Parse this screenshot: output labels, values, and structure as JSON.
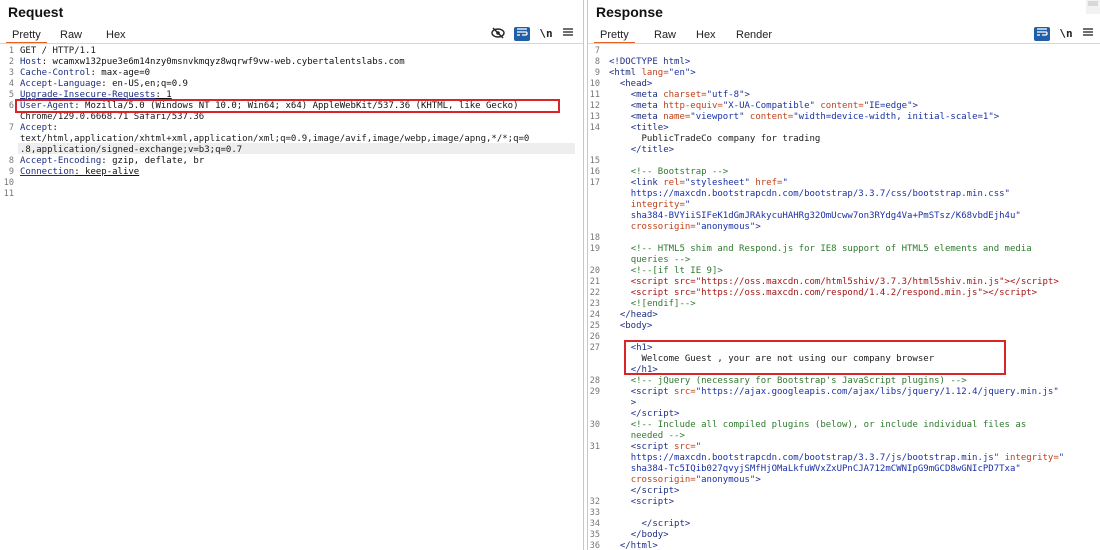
{
  "request": {
    "title": "Request",
    "tabs": [
      "Pretty",
      "Raw",
      "Hex"
    ],
    "tools": {
      "eye_off": "eye-off-icon",
      "wrap": "wrap-icon",
      "newline": "\\n",
      "menu": "menu-icon"
    },
    "lines": [
      {
        "n": "1",
        "key": "",
        "text": "GET / HTTP/1.1"
      },
      {
        "n": "2",
        "key": "Host",
        "text": ": wcamxw132pue3e6m14nzy0msnvkmqyz8wqrwf9vw-web.cybertalentslabs.com"
      },
      {
        "n": "3",
        "key": "Cache-Control",
        "text": ": max-age=0"
      },
      {
        "n": "4",
        "key": "Accept-Language",
        "text": ": en-US,en;q=0.9"
      },
      {
        "n": "5",
        "key": "Upgrade-Insecure-Requests",
        "text": ": 1"
      },
      {
        "n": "6",
        "key": "User-Agent",
        "text": ": Mozilla/5.0 (Windows NT 10.0; Win64; x64) AppleWebKit/537.36 (KHTML, like Gecko)"
      },
      {
        "n": "",
        "key": "",
        "text": "Chrome/129.0.6668.71 Safari/537.36"
      },
      {
        "n": "7",
        "key": "Accept",
        "text": ":"
      },
      {
        "n": "",
        "key": "",
        "text": "text/html,application/xhtml+xml,application/xml;q=0.9,image/avif,image/webp,image/apng,*/*;q=0"
      },
      {
        "n": "",
        "key": "",
        "text": ".8,application/signed-exchange;v=b3;q=0.7"
      },
      {
        "n": "8",
        "key": "Accept-Encoding",
        "text": ": gzip, deflate, br"
      },
      {
        "n": "9",
        "key": "Connection",
        "text": ": keep-alive"
      },
      {
        "n": "10",
        "key": "",
        "text": ""
      },
      {
        "n": "11",
        "key": "",
        "text": ""
      }
    ]
  },
  "response": {
    "title": "Response",
    "tabs": [
      "Pretty",
      "Raw",
      "Hex",
      "Render"
    ],
    "tools": {
      "wrap": "wrap-icon",
      "newline": "\\n",
      "menu": "menu-icon"
    },
    "lines": [
      {
        "n": "7",
        "html": ""
      },
      {
        "n": "8",
        "html": "<span class='tag'>&lt;!DOCTYPE html&gt;</span>"
      },
      {
        "n": "9",
        "html": "<span class='tag'>&lt;html</span> <span class='an'>lang=</span><span class='av'>\"en\"</span><span class='tag'>&gt;</span>"
      },
      {
        "n": "10",
        "html": "  <span class='tag'>&lt;head&gt;</span>"
      },
      {
        "n": "11",
        "html": "    <span class='tag'>&lt;meta</span> <span class='an'>charset=</span><span class='av'>\"utf-8\"</span><span class='tag'>&gt;</span>"
      },
      {
        "n": "12",
        "html": "    <span class='tag'>&lt;meta</span> <span class='an'>http-equiv=</span><span class='av'>\"X-UA-Compatible\"</span> <span class='an'>content=</span><span class='av'>\"IE=edge\"</span><span class='tag'>&gt;</span>"
      },
      {
        "n": "13",
        "html": "    <span class='tag'>&lt;meta</span> <span class='an'>name=</span><span class='av'>\"viewport\"</span> <span class='an'>content=</span><span class='av'>\"width=device-width, initial-scale=1\"</span><span class='tag'>&gt;</span>"
      },
      {
        "n": "14",
        "html": "    <span class='tag'>&lt;title&gt;</span>"
      },
      {
        "n": "",
        "html": "      PublicTradeCo company for trading"
      },
      {
        "n": "",
        "html": "    <span class='tag'>&lt;/title&gt;</span>"
      },
      {
        "n": "15",
        "html": ""
      },
      {
        "n": "16",
        "html": "    <span class='cm'>&lt;!-- Bootstrap --&gt;</span>"
      },
      {
        "n": "17",
        "html": "    <span class='tag'>&lt;link</span> <span class='an'>rel=</span><span class='av'>\"stylesheet\"</span> <span class='an'>href=</span><span class='av'>\"</span>"
      },
      {
        "n": "",
        "html": "    <span class='av'>https://maxcdn.bootstrapcdn.com/bootstrap/3.3.7/css/bootstrap.min.css\"</span>"
      },
      {
        "n": "",
        "html": "    <span class='an'>integrity=</span><span class='av'>\"</span>"
      },
      {
        "n": "",
        "html": "    <span class='av'>sha384-BVYiiSIFeK1dGmJRAkycuHAHRg32OmUcww7on3RYdg4Va+PmSTsz/K68vbdEjh4u\"</span>"
      },
      {
        "n": "",
        "html": "    <span class='an'>crossorigin=</span><span class='av'>\"anonymous\"</span><span class='tag'>&gt;</span>"
      },
      {
        "n": "18",
        "html": ""
      },
      {
        "n": "19",
        "html": "    <span class='cm'>&lt;!-- HTML5 shim and Respond.js for IE8 support of HTML5 elements and media</span>"
      },
      {
        "n": "",
        "html": "    <span class='cm'>queries --&gt;</span>"
      },
      {
        "n": "20",
        "html": "    <span class='cm'>&lt;!--[if lt IE 9]&gt;</span>"
      },
      {
        "n": "21",
        "html": "    <span class='sv'>&lt;script src=\"https://oss.maxcdn.com/html5shiv/3.7.3/html5shiv.min.js\"&gt;&lt;/script&gt;</span>"
      },
      {
        "n": "22",
        "html": "    <span class='sv'>&lt;script src=\"https://oss.maxcdn.com/respond/1.4.2/respond.min.js\"&gt;&lt;/script&gt;</span>"
      },
      {
        "n": "23",
        "html": "    <span class='cm'>&lt;![endif]--&gt;</span>"
      },
      {
        "n": "24",
        "html": "  <span class='tag'>&lt;/head&gt;</span>"
      },
      {
        "n": "25",
        "html": "  <span class='tag'>&lt;body&gt;</span>"
      },
      {
        "n": "26",
        "html": ""
      },
      {
        "n": "27",
        "html": "    <span class='tag'>&lt;h1&gt;</span>"
      },
      {
        "n": "",
        "html": "      Welcome Guest , your are not using our company browser"
      },
      {
        "n": "",
        "html": "    <span class='tag'>&lt;/h1&gt;</span>"
      },
      {
        "n": "28",
        "html": "    <span class='cm'>&lt;!-- jQuery (necessary for Bootstrap's JavaScript plugins) --&gt;</span>"
      },
      {
        "n": "29",
        "html": "    <span class='tag'>&lt;script</span> <span class='an'>src=</span><span class='av'>\"https://ajax.googleapis.com/ajax/libs/jquery/1.12.4/jquery.min.js\"</span>"
      },
      {
        "n": "",
        "html": "    <span class='tag'>&gt;</span>"
      },
      {
        "n": "",
        "html": "    <span class='tag'>&lt;/script&gt;</span>"
      },
      {
        "n": "30",
        "html": "    <span class='cm'>&lt;!-- Include all compiled plugins (below), or include individual files as</span>"
      },
      {
        "n": "",
        "html": "    <span class='cm'>needed --&gt;</span>"
      },
      {
        "n": "31",
        "html": "    <span class='tag'>&lt;script</span> <span class='an'>src=</span><span class='av'>\"</span>"
      },
      {
        "n": "",
        "html": "    <span class='av'>https://maxcdn.bootstrapcdn.com/bootstrap/3.3.7/js/bootstrap.min.js\"</span> <span class='an'>integrity=</span><span class='av'>\"</span>"
      },
      {
        "n": "",
        "html": "    <span class='av'>sha384-Tc5IQib027qvyjSMfHjOMaLkfuWVxZxUPnCJA712mCWNIpG9mGCD8wGNIcPD7Txa\"</span>"
      },
      {
        "n": "",
        "html": "    <span class='an'>crossorigin=</span><span class='av'>\"anonymous\"</span><span class='tag'>&gt;</span>"
      },
      {
        "n": "",
        "html": "    <span class='tag'>&lt;/script&gt;</span>"
      },
      {
        "n": "32",
        "html": "    <span class='tag'>&lt;script&gt;</span>"
      },
      {
        "n": "33",
        "html": ""
      },
      {
        "n": "34",
        "html": "      <span class='tag'>&lt;/script&gt;</span>"
      },
      {
        "n": "35",
        "html": "    <span class='tag'>&lt;/body&gt;</span>"
      },
      {
        "n": "36",
        "html": "  <span class='tag'>&lt;/html&gt;</span>"
      }
    ]
  },
  "colors": {
    "highlight": "#d9252a",
    "active_tab": "#e8601c",
    "tool_blue": "#1f5fa8"
  }
}
